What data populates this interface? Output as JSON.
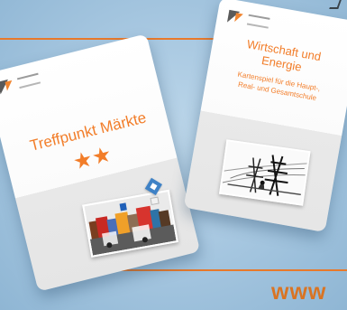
{
  "left_card": {
    "title": "Treffpunkt Märkte",
    "stars": "★★",
    "icon_name": "brand-logo-icon",
    "photo": "market-photo"
  },
  "right_card": {
    "title_line_1": "Wirtschaft und",
    "title_line_2": "Energie",
    "subtitle_line_1": "Kartenspiel für die Haupt-,",
    "subtitle_line_2": "Real- und Gesamtschule",
    "icon_name": "brand-logo-icon",
    "photo": "power-line-photo"
  },
  "footer": {
    "url_fragment": "www"
  },
  "colors": {
    "accent": "#f27d29",
    "accent_dark": "#d97423",
    "background": "#a8c8e1"
  }
}
